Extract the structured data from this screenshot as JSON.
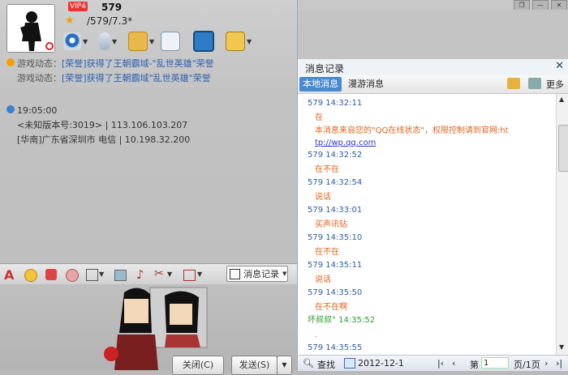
{
  "profile": {
    "vip_badge": "VIP4",
    "nickname": "579",
    "signature": "/579/7.3*"
  },
  "news": {
    "label": "游戏动态：",
    "items": [
      "[荣誉]获得了王朝霸域-\"乱世英雄\"荣誉",
      "[荣誉]获得了王朝霸域\"乱世英雄\"荣誉"
    ]
  },
  "info": {
    "time": "19:05:00",
    "version": "<未知版本号:3019>  |  113.106.103.207",
    "location": "[华南]广东省深圳市 电信  |  10.198.32.200"
  },
  "input_bar": {
    "history_button": "消息记录"
  },
  "buttons": {
    "close": "关闭(C)",
    "send": "发送(S)"
  },
  "panel": {
    "title": "消息记录",
    "tab_local": "本地消息",
    "tab_roam": "漫游消息",
    "more": "更多"
  },
  "messages": [
    {
      "header": "579 14:32:11",
      "lines": [
        "在"
      ]
    },
    {
      "header": "",
      "lines": [
        "本消息来自您的\"QQ在线状态\"，权限控制请到官网:ht"
      ]
    },
    {
      "header": "",
      "lines": [
        "tp://wp.qq.com"
      ]
    },
    {
      "header": "579 14:32:52",
      "lines": [
        "在不在"
      ]
    },
    {
      "header": "579 14:32:54",
      "lines": [
        "说话"
      ]
    },
    {
      "header": "579 14:33:01",
      "lines": [
        "买声讯钻"
      ]
    },
    {
      "header": "579 14:35:10",
      "lines": [
        "在不在"
      ]
    },
    {
      "header": "579 14:35:11",
      "lines": [
        "说话"
      ]
    },
    {
      "header": "579 14:35:50",
      "lines": [
        "在不在啊"
      ]
    },
    {
      "header": "坏叔叔° 14:35:52",
      "lines": [
        "."
      ]
    },
    {
      "header": "579 14:35:55",
      "lines": [
        ""
      ]
    }
  ],
  "footer": {
    "search": "查找",
    "date": "2012-12-1",
    "page_prefix": "第",
    "page_value": "1",
    "page_suffix": "页/1页"
  },
  "colors": {
    "accent": "#4a89d0",
    "header_blue": "#2b5ca8",
    "message_orange": "#e0631a",
    "self_green": "#2e9a2e"
  }
}
